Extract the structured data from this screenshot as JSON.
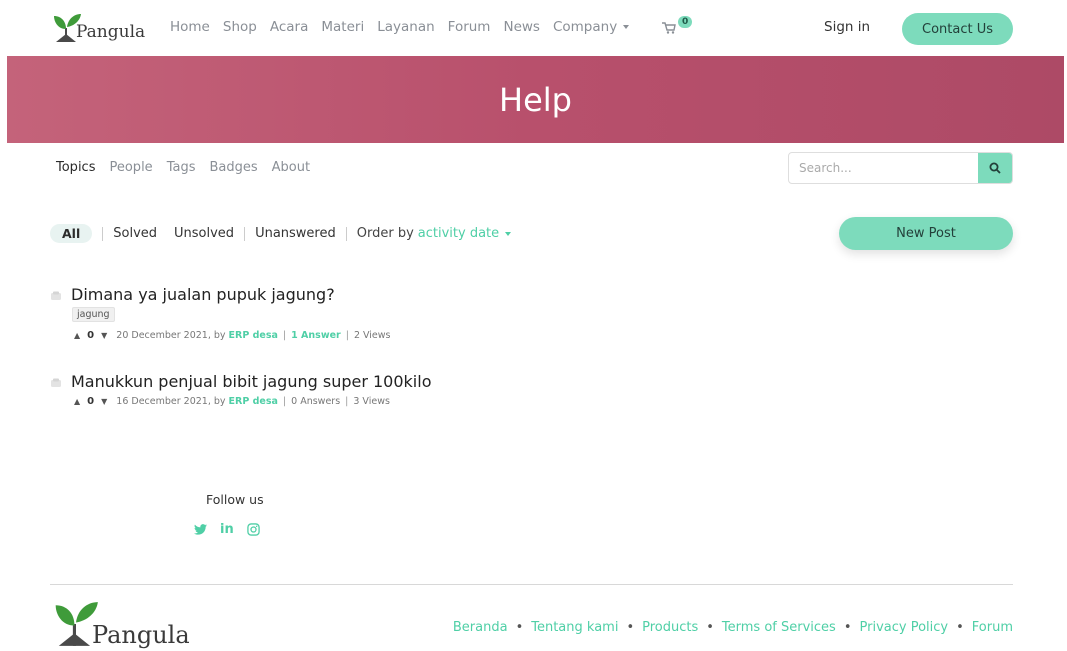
{
  "brand": {
    "name": "Pangula"
  },
  "nav": {
    "items": [
      "Home",
      "Shop",
      "Acara",
      "Materi",
      "Layanan",
      "Forum",
      "News",
      "Company"
    ],
    "cart_count": "0",
    "signin": "Sign in",
    "contact": "Contact Us"
  },
  "banner": {
    "title": "Help"
  },
  "subnav": {
    "items": [
      "Topics",
      "People",
      "Tags",
      "Badges",
      "About"
    ]
  },
  "search": {
    "placeholder": "Search..."
  },
  "filters": {
    "all": "All",
    "solved": "Solved",
    "unsolved": "Unsolved",
    "unanswered": "Unanswered",
    "order_label": "Order by",
    "order_value": "activity date"
  },
  "new_post": "New Post",
  "posts": [
    {
      "title": "Dimana ya jualan pupuk jagung?",
      "tag": "jagung",
      "votes": "0",
      "date": "20 December 2021, by",
      "author": "ERP desa",
      "answers": "1 Answer",
      "views": "2 Views"
    },
    {
      "title": "Manukkun penjual bibit jagung super 100kilo",
      "votes": "0",
      "date": "16 December 2021, by",
      "author": "ERP desa",
      "answers": "0 Answers",
      "views": "3 Views"
    }
  ],
  "follow": {
    "label": "Follow us",
    "twitter": "twitter-icon",
    "linkedin": "in",
    "instagram": "instagram-icon"
  },
  "footer": {
    "links": [
      "Beranda",
      "Tentang kami",
      "Products",
      "Terms of Services",
      "Privacy Policy",
      "Forum"
    ]
  },
  "colors": {
    "accent": "#7ddbbc",
    "accent_text": "#4fcfa6",
    "banner": "#b8506c"
  }
}
